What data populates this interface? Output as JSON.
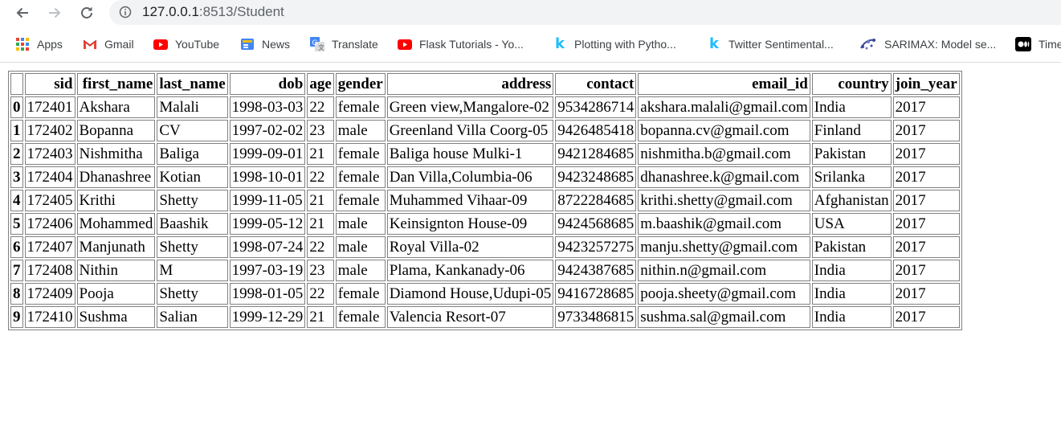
{
  "browser": {
    "url_host": "127.0.0.1",
    "url_rest": ":8513/Student",
    "bookmarks": [
      {
        "label": "Apps",
        "icon": "apps-grid-icon"
      },
      {
        "label": "Gmail",
        "icon": "gmail-icon"
      },
      {
        "label": "YouTube",
        "icon": "youtube-icon"
      },
      {
        "label": "News",
        "icon": "google-news-icon"
      },
      {
        "label": "Translate",
        "icon": "translate-icon"
      },
      {
        "label": "Flask Tutorials - Yo...",
        "icon": "youtube-icon"
      },
      {
        "label": "Plotting with Pytho...",
        "icon": "kaggle-icon"
      },
      {
        "label": "Twitter Sentimental...",
        "icon": "kaggle-icon"
      },
      {
        "label": "SARIMAX: Model se...",
        "icon": "statsmodels-icon"
      },
      {
        "label": "Time",
        "icon": "medium-icon"
      }
    ]
  },
  "table": {
    "headers": [
      "",
      "sid",
      "first_name",
      "last_name",
      "dob",
      "age",
      "gender",
      "address",
      "contact",
      "email_id",
      "country",
      "join_year"
    ],
    "rows": [
      [
        "0",
        "172401",
        "Akshara",
        "Malali",
        "1998-03-03",
        "22",
        "female",
        "Green view,Mangalore-02",
        "9534286714",
        "akshara.malali@gmail.com",
        "India",
        "2017"
      ],
      [
        "1",
        "172402",
        "Bopanna",
        "CV",
        "1997-02-02",
        "23",
        "male",
        "Greenland Villa Coorg-05",
        "9426485418",
        "bopanna.cv@gmail.com",
        "Finland",
        "2017"
      ],
      [
        "2",
        "172403",
        "Nishmitha",
        "Baliga",
        "1999-09-01",
        "21",
        "female",
        "Baliga house Mulki-1",
        "9421284685",
        "nishmitha.b@gmail.com",
        "Pakistan",
        "2017"
      ],
      [
        "3",
        "172404",
        "Dhanashree",
        "Kotian",
        "1998-10-01",
        "22",
        "female",
        "Dan Villa,Columbia-06",
        "9423248685",
        "dhanashree.k@gmail.com",
        "Srilanka",
        "2017"
      ],
      [
        "4",
        "172405",
        "Krithi",
        "Shetty",
        "1999-11-05",
        "21",
        "female",
        "Muhammed Vihaar-09",
        "8722284685",
        "krithi.shetty@gmail.com",
        "Afghanistan",
        "2017"
      ],
      [
        "5",
        "172406",
        "Mohammed",
        "Baashik",
        "1999-05-12",
        "21",
        "male",
        "Keinsignton House-09",
        "9424568685",
        "m.baashik@gmail.com",
        "USA",
        "2017"
      ],
      [
        "6",
        "172407",
        "Manjunath",
        "Shetty",
        "1998-07-24",
        "22",
        "male",
        "Royal Villa-02",
        "9423257275",
        "manju.shetty@gmail.com",
        "Pakistan",
        "2017"
      ],
      [
        "7",
        "172408",
        "Nithin",
        "M",
        "1997-03-19",
        "23",
        "male",
        "Plama, Kankanady-06",
        "9424387685",
        "nithin.n@gmail.com",
        "India",
        "2017"
      ],
      [
        "8",
        "172409",
        "Pooja",
        "Shetty",
        "1998-01-05",
        "22",
        "female",
        "Diamond House,Udupi-05",
        "9416728685",
        "pooja.sheety@gmail.com",
        "India",
        "2017"
      ],
      [
        "9",
        "172410",
        "Sushma",
        "Salian",
        "1999-12-29",
        "21",
        "female",
        "Valencia Resort-07",
        "9733486815",
        "sushma.sal@gmail.com",
        "India",
        "2017"
      ]
    ]
  }
}
